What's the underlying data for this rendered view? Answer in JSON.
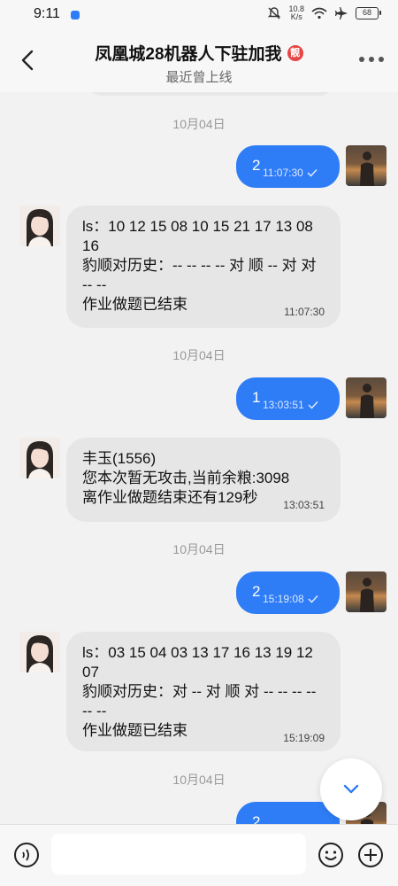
{
  "status_bar": {
    "time": "9:11",
    "net_speed_value": "10.8",
    "net_speed_unit": "K/s",
    "battery": "68"
  },
  "header": {
    "title": "凤凰城28机器人下驻加我",
    "badge": "靓",
    "subtitle": "最近曾上线"
  },
  "composer": {
    "placeholder": ""
  },
  "messages": [
    {
      "type": "date",
      "text": "10月04日"
    },
    {
      "type": "out",
      "text": "2",
      "time": "11:07:30"
    },
    {
      "type": "in",
      "lines": [
        "ls：10 12 15 08 10 15 21 17 13 08 16",
        "豹顺对历史：-- -- -- -- 对 顺 -- 对 对 -- --",
        "作业做题已结束"
      ],
      "time": "11:07:30"
    },
    {
      "type": "date",
      "text": "10月04日"
    },
    {
      "type": "out",
      "text": "1",
      "time": "13:03:51"
    },
    {
      "type": "in",
      "lines": [
        "丰玉(1556)",
        "您本次暂无攻击,当前余粮:3098",
        "离作业做题结束还有129秒"
      ],
      "time": "13:03:51"
    },
    {
      "type": "date",
      "text": "10月04日"
    },
    {
      "type": "out",
      "text": "2",
      "time": "15:19:08"
    },
    {
      "type": "in",
      "lines": [
        "ls：03 15 04 03 13 17 16 13 19 12 07",
        "豹顺对历史：对 -- 对 顺 对 -- -- -- -- -- --",
        "作业做题已结束"
      ],
      "time": "15:19:09"
    },
    {
      "type": "date",
      "text": "10月04日"
    },
    {
      "type": "out",
      "text": "2",
      "time": ""
    }
  ],
  "colors": {
    "accent": "#2f7df6",
    "incoming_bubble": "#e6e6e6",
    "background": "#f2f2f2"
  }
}
